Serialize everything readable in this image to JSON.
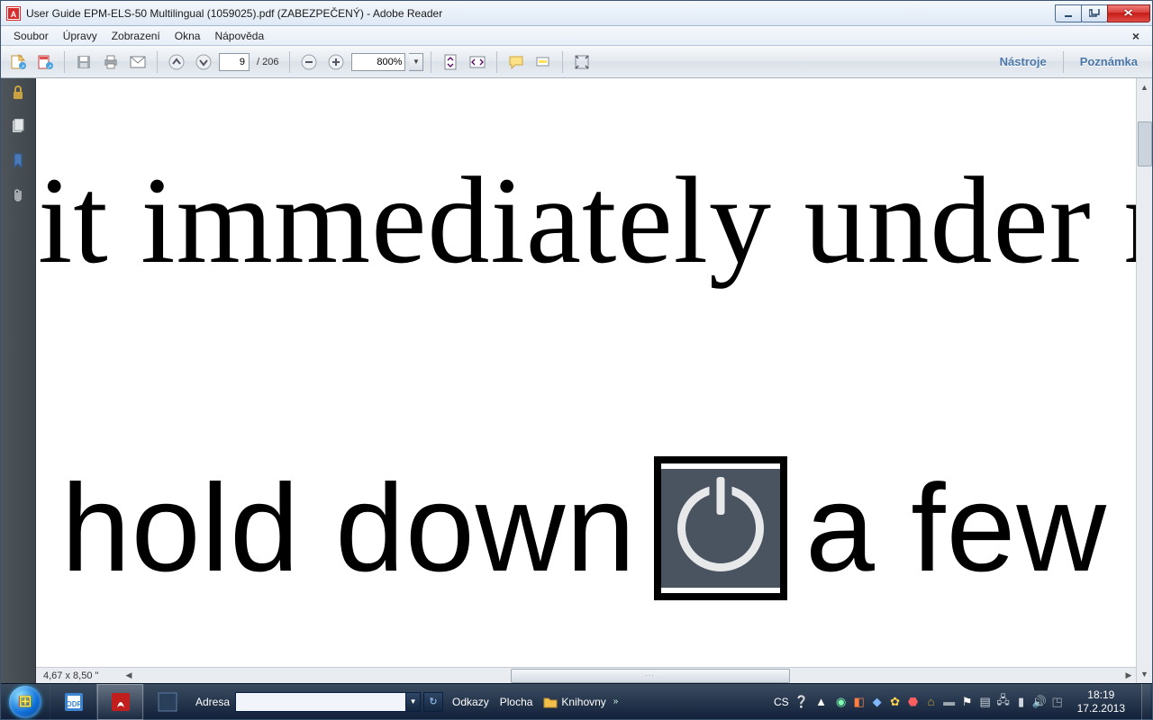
{
  "window": {
    "title": "User Guide EPM-ELS-50 Multilingual (1059025).pdf (ZABEZPEČENÝ) - Adobe Reader"
  },
  "menubar": {
    "items": [
      "Soubor",
      "Úpravy",
      "Zobrazení",
      "Okna",
      "Nápověda"
    ]
  },
  "toolbar": {
    "page_current": "9",
    "page_total": "/ 206",
    "zoom": "800%",
    "nastroje": "Nástroje",
    "poznamka": "Poznámka"
  },
  "document": {
    "line1": "it immediately under norma",
    "line2a": "hold down",
    "line2b": "a few secon"
  },
  "statusbar": {
    "dims": "4,67 x 8,50 \""
  },
  "taskbar": {
    "adresa_label": "Adresa",
    "adresa_value": "",
    "odkazy": "Odkazy",
    "plocha": "Plocha",
    "knihovny": "Knihovny",
    "lang": "CS",
    "time": "18:19",
    "date": "17.2.2013"
  }
}
